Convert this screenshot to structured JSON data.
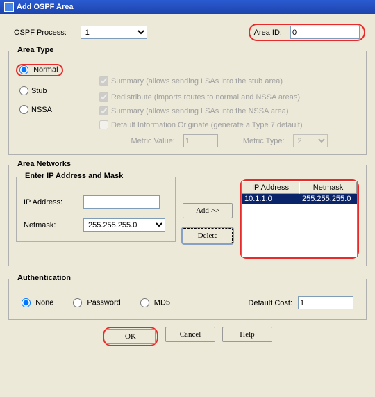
{
  "window": {
    "title": "Add OSPF Area"
  },
  "top": {
    "process_label": "OSPF Process:",
    "process_value": "1",
    "areaid_label": "Area ID:",
    "areaid_value": "0"
  },
  "areaType": {
    "legend": "Area Type",
    "radios": {
      "normal": "Normal",
      "stub": "Stub",
      "nssa": "NSSA",
      "selected": "normal"
    },
    "checks": {
      "summary_stub": "Summary (allows sending LSAs into the stub area)",
      "redistribute": "Redistribute (imports routes to normal and NSSA areas)",
      "summary_nssa": "Summary (allows sending LSAs into the NSSA area)",
      "default_info": "Default Information Originate (generate a Type 7 default)"
    },
    "metric_value_label": "Metric Value:",
    "metric_value": "1",
    "metric_type_label": "Metric Type:",
    "metric_type": "2"
  },
  "areaNetworks": {
    "legend": "Area Networks",
    "enter_legend": "Enter IP Address and Mask",
    "ip_label": "IP Address:",
    "ip_value": "",
    "netmask_label": "Netmask:",
    "netmask_value": "255.255.255.0",
    "btn_add": "Add >>",
    "btn_delete": "Delete",
    "cols": {
      "ip": "IP Address",
      "mask": "Netmask"
    },
    "rows": [
      {
        "ip": "10.1.1.0",
        "mask": "255.255.255.0"
      }
    ]
  },
  "auth": {
    "legend": "Authentication",
    "none": "None",
    "password": "Password",
    "md5": "MD5",
    "selected": "none",
    "default_cost_label": "Default Cost:",
    "default_cost_value": "1"
  },
  "buttons": {
    "ok": "OK",
    "cancel": "Cancel",
    "help": "Help"
  }
}
